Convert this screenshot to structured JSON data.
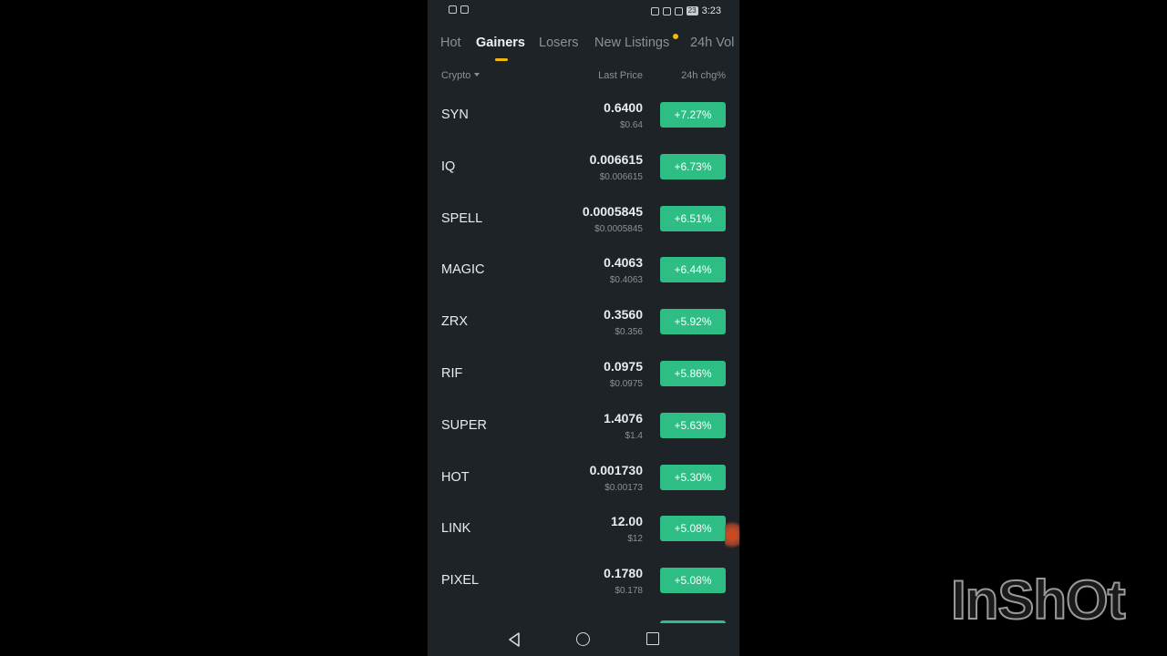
{
  "status_bar": {
    "time": "3:23",
    "battery": "23"
  },
  "tabs": [
    {
      "label": "Hot",
      "active": false
    },
    {
      "label": "Gainers",
      "active": true
    },
    {
      "label": "Losers",
      "active": false
    },
    {
      "label": "New Listings",
      "active": false,
      "has_dot": true
    },
    {
      "label": "24h Vol",
      "active": false
    }
  ],
  "columns": {
    "crypto": "Crypto",
    "last_price": "Last Price",
    "change": "24h chg%"
  },
  "rows": [
    {
      "symbol": "SYN",
      "price": "0.6400",
      "usd": "$0.64",
      "change": "+7.27%"
    },
    {
      "symbol": "IQ",
      "price": "0.006615",
      "usd": "$0.006615",
      "change": "+6.73%"
    },
    {
      "symbol": "SPELL",
      "price": "0.0005845",
      "usd": "$0.0005845",
      "change": "+6.51%"
    },
    {
      "symbol": "MAGIC",
      "price": "0.4063",
      "usd": "$0.4063",
      "change": "+6.44%"
    },
    {
      "symbol": "ZRX",
      "price": "0.3560",
      "usd": "$0.356",
      "change": "+5.92%"
    },
    {
      "symbol": "RIF",
      "price": "0.0975",
      "usd": "$0.0975",
      "change": "+5.86%"
    },
    {
      "symbol": "SUPER",
      "price": "1.4076",
      "usd": "$1.4",
      "change": "+5.63%"
    },
    {
      "symbol": "HOT",
      "price": "0.001730",
      "usd": "$0.00173",
      "change": "+5.30%"
    },
    {
      "symbol": "LINK",
      "price": "12.00",
      "usd": "$12",
      "change": "+5.08%"
    },
    {
      "symbol": "PIXEL",
      "price": "0.1780",
      "usd": "$0.178",
      "change": "+5.08%"
    }
  ],
  "colors": {
    "accent": "#f0b90b",
    "positive": "#2ebd85",
    "background": "#1e2327"
  },
  "watermark": "InShOt"
}
